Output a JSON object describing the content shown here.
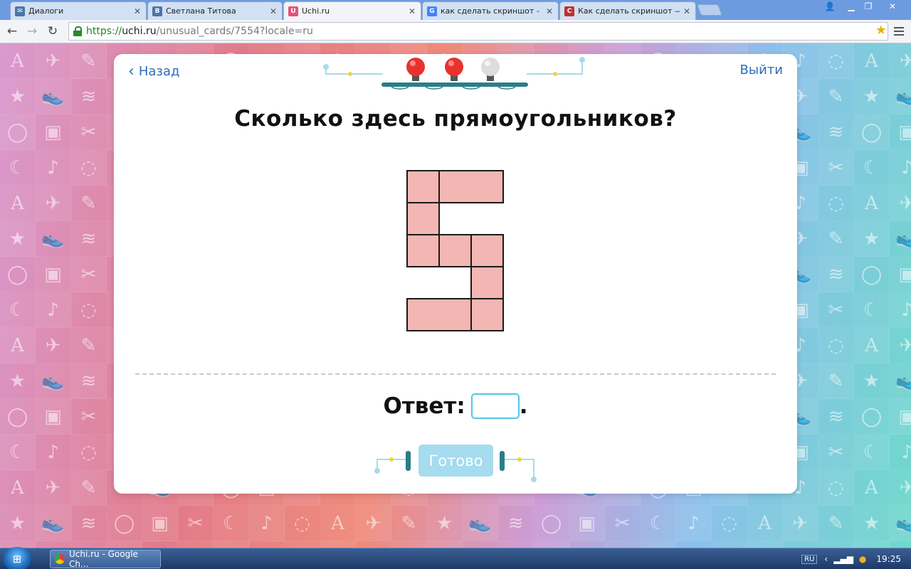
{
  "browser": {
    "tabs": [
      {
        "title": "Диалоги",
        "favicon": "vk-message-icon",
        "color": "#4a76a8",
        "active": false
      },
      {
        "title": "Светлана Титова",
        "favicon": "vk-icon",
        "color": "#4a76a8",
        "active": false
      },
      {
        "title": "Uchi.ru",
        "favicon": "uchi-icon",
        "color": "#e8507a",
        "active": true
      },
      {
        "title": "как сделать скриншот - По",
        "favicon": "google-icon",
        "color": "#4285f4",
        "active": false
      },
      {
        "title": "Как сделать скриншот — С",
        "favicon": "article-icon",
        "color": "#c03030",
        "active": false
      }
    ],
    "url": {
      "scheme": "https://",
      "host": "uchi.ru",
      "path": "/unusual_cards/7554?locale=ru"
    }
  },
  "card": {
    "back_label": "Назад",
    "exit_label": "Выйти",
    "question": "Сколько здесь прямоугольников?",
    "answer_label": "Ответ:",
    "answer_suffix": ".",
    "answer_value": "",
    "ready_label": "Готово",
    "progress_lights": [
      "red",
      "red",
      "gray"
    ],
    "figure_fill": "#f4b6b2",
    "figure_stroke": "#1a1a1a"
  },
  "taskbar": {
    "task_label": "Uchi.ru - Google Ch...",
    "lang": "RU",
    "clock": "19:25"
  }
}
